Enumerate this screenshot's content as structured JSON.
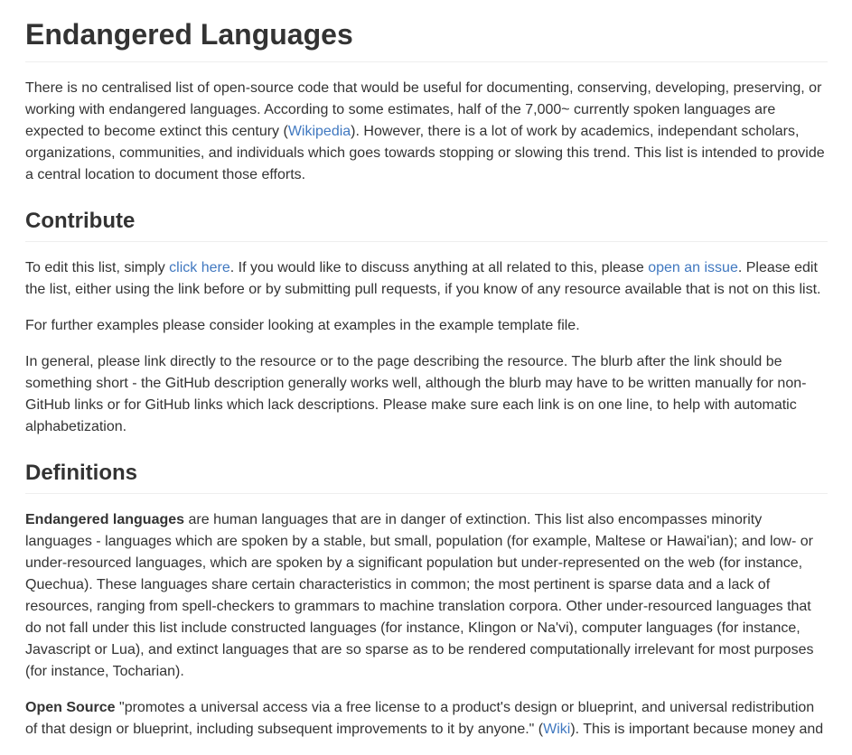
{
  "title": "Endangered Languages",
  "intro": {
    "t1": "There is no centralised list of open-source code that would be useful for documenting, conserving, developing, preserving, or working with endangered languages. According to some estimates, half of the 7,000~ currently spoken languages are expected to become extinct this century (",
    "link": "Wikipedia",
    "t2": "). However, there is a lot of work by academics, independant scholars, organizations, communities, and individuals which goes towards stopping or slowing this trend. This list is intended to provide a central location to document those efforts."
  },
  "contribute": {
    "heading": "Contribute",
    "p1_t1": "To edit this list, simply ",
    "p1_link1": "click here",
    "p1_t2": ". If you would like to discuss anything at all related to this, please ",
    "p1_link2": "open an issue",
    "p1_t3": ". Please edit the list, either using the link before or by submitting pull requests, if you know of any resource available that is not on this list.",
    "p2": "For further examples please consider looking at examples in the example template file.",
    "p3": "In general, please link directly to the resource or to the page describing the resource. The blurb after the link should be something short - the GitHub description generally works well, although the blurb may have to be written manually for non-GitHub links or for GitHub links which lack descriptions. Please make sure each link is on one line, to help with automatic alphabetization."
  },
  "definitions": {
    "heading": "Definitions",
    "d1_term": "Endangered languages",
    "d1_text": " are human languages that are in danger of extinction. This list also encompasses minority languages - languages which are spoken by a stable, but small, population (for example, Maltese or Hawai'ian); and low- or under-resourced languages, which are spoken by a significant population but under-represented on the web (for instance, Quechua). These languages share certain characteristics in common; the most pertinent is sparse data and a lack of resources, ranging from spell-checkers to grammars to machine translation corpora. Other under-resourced languages that do not fall under this list include constructed languages (for instance, Klingon or Na'vi), computer languages (for instance, Javascript or Lua), and extinct languages that are so sparse as to be rendered computationally irrelevant for most purposes (for instance, Tocharian).",
    "d2_term": "Open Source",
    "d2_t1": " \"promotes a universal access via a free license to a product's design or blueprint, and universal redistribution of that design or blueprint, including subsequent improvements to it by anyone.\" (",
    "d2_link": "Wiki",
    "d2_t2": "). This is important because money and"
  }
}
